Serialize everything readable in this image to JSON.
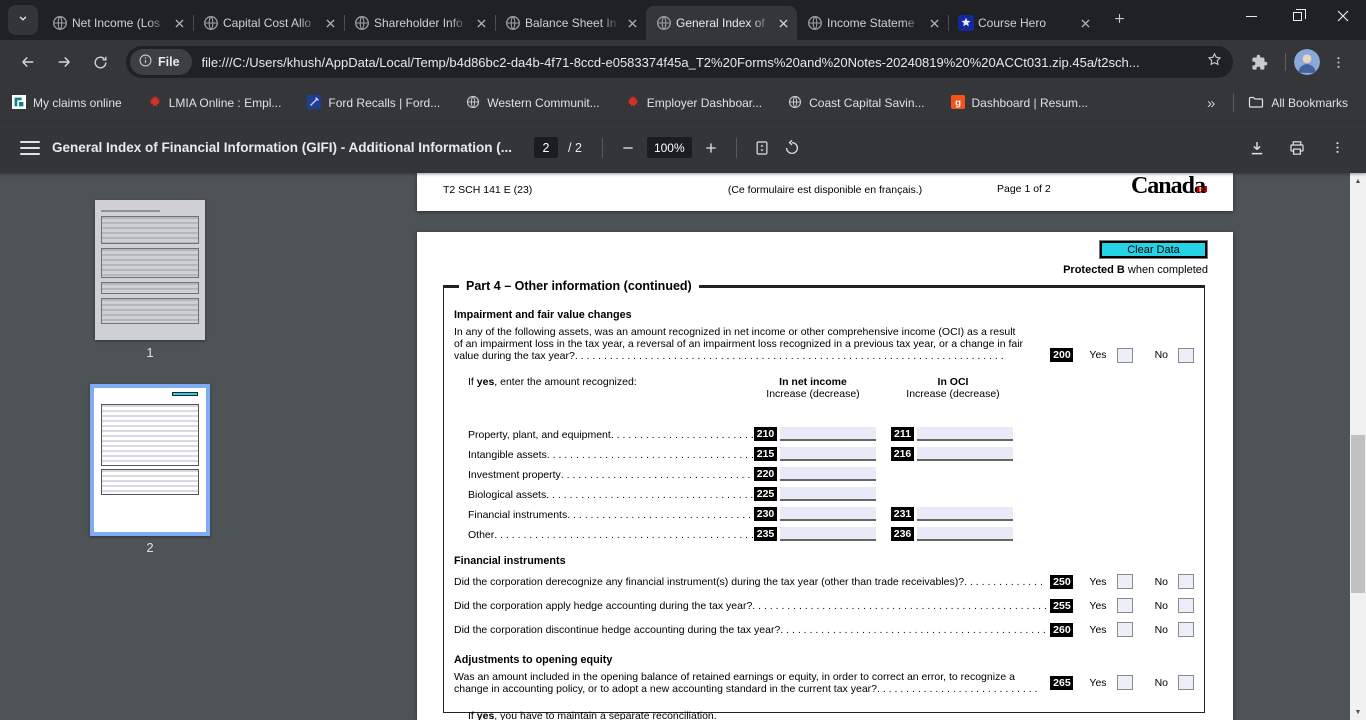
{
  "browser": {
    "tabs": [
      {
        "label": "Net Income (Los",
        "icon": "globe-favicon"
      },
      {
        "label": "Capital Cost Allo",
        "icon": "globe-favicon"
      },
      {
        "label": "Shareholder Info",
        "icon": "globe-favicon"
      },
      {
        "label": "Balance Sheet In",
        "icon": "globe-favicon"
      },
      {
        "label": "General Index of",
        "icon": "globe-favicon",
        "active": true
      },
      {
        "label": "Income Stateme",
        "icon": "globe-favicon"
      },
      {
        "label": "Course Hero",
        "icon": "course-hero-favicon"
      }
    ],
    "address_bar": {
      "chip_label": "File",
      "url": "file:///C:/Users/khush/AppData/Local/Temp/b4d86bc2-da4b-4f71-8ccd-e0583374f45a_T2%20Forms%20and%20Notes-20240819%20%20ACCt031.zip.45a/t2sch..."
    },
    "bookmarks": [
      {
        "label": "My claims online",
        "icon": "claims-logo-icon"
      },
      {
        "label": "LMIA Online : Empl...",
        "icon": "maple-leaf-icon"
      },
      {
        "label": "Ford Recalls | Ford...",
        "icon": "ford-logo-icon"
      },
      {
        "label": "Western Communit...",
        "icon": "globe-icon"
      },
      {
        "label": "Employer Dashboar...",
        "icon": "maple-leaf-icon"
      },
      {
        "label": "Coast Capital Savin...",
        "icon": "globe-icon"
      },
      {
        "label": "Dashboard | Resum...",
        "icon": "g-logo-icon"
      }
    ],
    "bookmarks_overflow": "»",
    "all_bookmarks_label": "All Bookmarks"
  },
  "pdf_toolbar": {
    "title": "General Index of Financial Information (GIFI) - Additional Information (...",
    "page_current": "2",
    "page_separator": "/",
    "page_total": "2",
    "zoom_level": "100%"
  },
  "sidebar": {
    "thumbnails": [
      {
        "page_label": "1",
        "selected": false
      },
      {
        "page_label": "2",
        "selected": true
      }
    ]
  },
  "form": {
    "page1_footer": {
      "form_code": "T2 SCH 141 E (23)",
      "french_note": "(Ce formulaire est disponible en français.)",
      "page_indicator": "Page 1 of 2",
      "wordmark": "Canada"
    },
    "clear_data_label": "Clear Data",
    "clear_button_color": "#25d3e6",
    "field_fill_color": "#e9eaf8",
    "protected_bold": "Protected B",
    "protected_rest": " when completed",
    "part4": {
      "title": "Part 4 – Other information (continued)",
      "yes_label": "Yes",
      "no_label": "No",
      "impairment": {
        "heading": "Impairment and fair value changes",
        "line1": "In any of the following assets, was an amount recognized in net income or other comprehensive income (OCI) as a result",
        "line2": "of an impairment loss in the tax year, a reversal of an impairment loss recognized in a previous tax year, or a change in fair",
        "line3": "value during the tax year?",
        "code": "200",
        "ifyes_prefix": "If ",
        "ifyes_bold": "yes",
        "ifyes_rest": ", enter the amount recognized:",
        "col_net_income": "In net income",
        "col_net_income_sub": "Increase (decrease)",
        "col_oci": "In OCI",
        "col_oci_sub": "Increase (decrease)",
        "rows": [
          {
            "label": "Property, plant, and equipment",
            "code_net": "210",
            "code_oci": "211"
          },
          {
            "label": "Intangible assets",
            "code_net": "215",
            "code_oci": "216"
          },
          {
            "label": "Investment property",
            "code_net": "220"
          },
          {
            "label": "Biological assets",
            "code_net": "225"
          },
          {
            "label": "Financial instruments",
            "code_net": "230",
            "code_oci": "231"
          },
          {
            "label": "Other",
            "code_net": "235",
            "code_oci": "236"
          }
        ]
      },
      "financial_instruments": {
        "heading": "Financial instruments",
        "questions": [
          {
            "text": "Did the corporation derecognize any financial instrument(s) during the tax year (other than trade receivables)?",
            "code": "250"
          },
          {
            "text": "Did the corporation apply hedge accounting during the tax year?",
            "code": "255"
          },
          {
            "text": "Did the corporation discontinue hedge accounting during the tax year?",
            "code": "260"
          }
        ]
      },
      "opening_equity": {
        "heading": "Adjustments to opening equity",
        "line1": "Was an amount included in the opening balance of retained earnings or equity, in order to correct an error, to recognize a",
        "line2": "change in accounting policy, or to adopt a new accounting standard in the current tax year?",
        "code": "265",
        "note_prefix": "If ",
        "note_bold": "yes",
        "note_rest": ", you have to maintain a separate reconciliation."
      }
    }
  }
}
